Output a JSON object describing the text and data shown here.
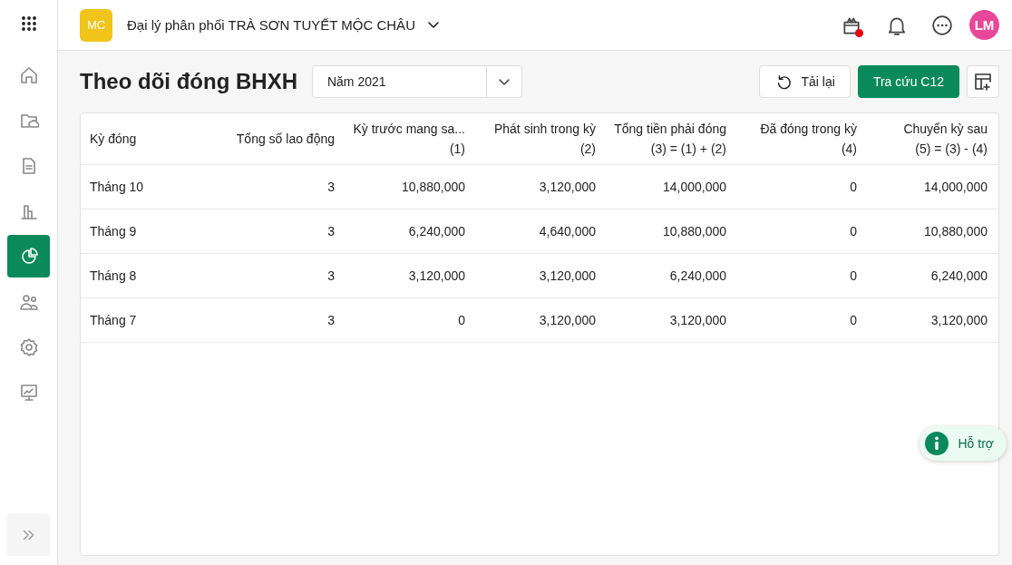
{
  "app_bar": {
    "org_badge": "MC",
    "org_name": "Đại lý phân phối TRÀ SƠN TUYẾT MỘC CHÂU",
    "gift_has_alert": true,
    "avatar": "LM"
  },
  "sidebar": {
    "items": [
      {
        "kind": "home",
        "selected": false
      },
      {
        "kind": "folder",
        "selected": false
      },
      {
        "kind": "document",
        "selected": false
      },
      {
        "kind": "bar",
        "selected": false
      },
      {
        "kind": "pie",
        "selected": true
      },
      {
        "kind": "people",
        "selected": false
      },
      {
        "kind": "settings",
        "selected": false
      },
      {
        "kind": "monitor",
        "selected": false
      }
    ]
  },
  "page": {
    "title": "Theo dõi đóng BHXH",
    "year_select": {
      "value": "Năm 2021"
    },
    "buttons": [
      {
        "kind": "reload",
        "label": "Tải lại"
      },
      {
        "kind": "primary",
        "label": "Tra cứu C12"
      },
      {
        "kind": "table-add"
      }
    ]
  },
  "table": {
    "columns": [
      {
        "label": "Kỳ đóng"
      },
      {
        "label": "Tổng số lao động"
      },
      {
        "label": "Kỳ trước mang sa...",
        "sub": "(1)"
      },
      {
        "label": "Phát sinh trong kỳ",
        "sub": "(2)"
      },
      {
        "label": "Tổng tiền phải đóng",
        "sub": "(3) = (1) + (2)"
      },
      {
        "label": "Đã đóng trong kỳ",
        "sub": "(4)"
      },
      {
        "label": "Chuyển kỳ sau",
        "sub": "(5) = (3) - (4)"
      }
    ],
    "rows": [
      [
        "Tháng 10",
        "3",
        "10,880,000",
        "3,120,000",
        "14,000,000",
        "0",
        "14,000,000"
      ],
      [
        "Tháng 9",
        "3",
        "6,240,000",
        "4,640,000",
        "10,880,000",
        "0",
        "10,880,000"
      ],
      [
        "Tháng 8",
        "3",
        "3,120,000",
        "3,120,000",
        "6,240,000",
        "0",
        "6,240,000"
      ],
      [
        "Tháng 7",
        "3",
        "0",
        "3,120,000",
        "3,120,000",
        "0",
        "3,120,000"
      ]
    ]
  },
  "support_button": {
    "label": "Hỗ trợ"
  }
}
